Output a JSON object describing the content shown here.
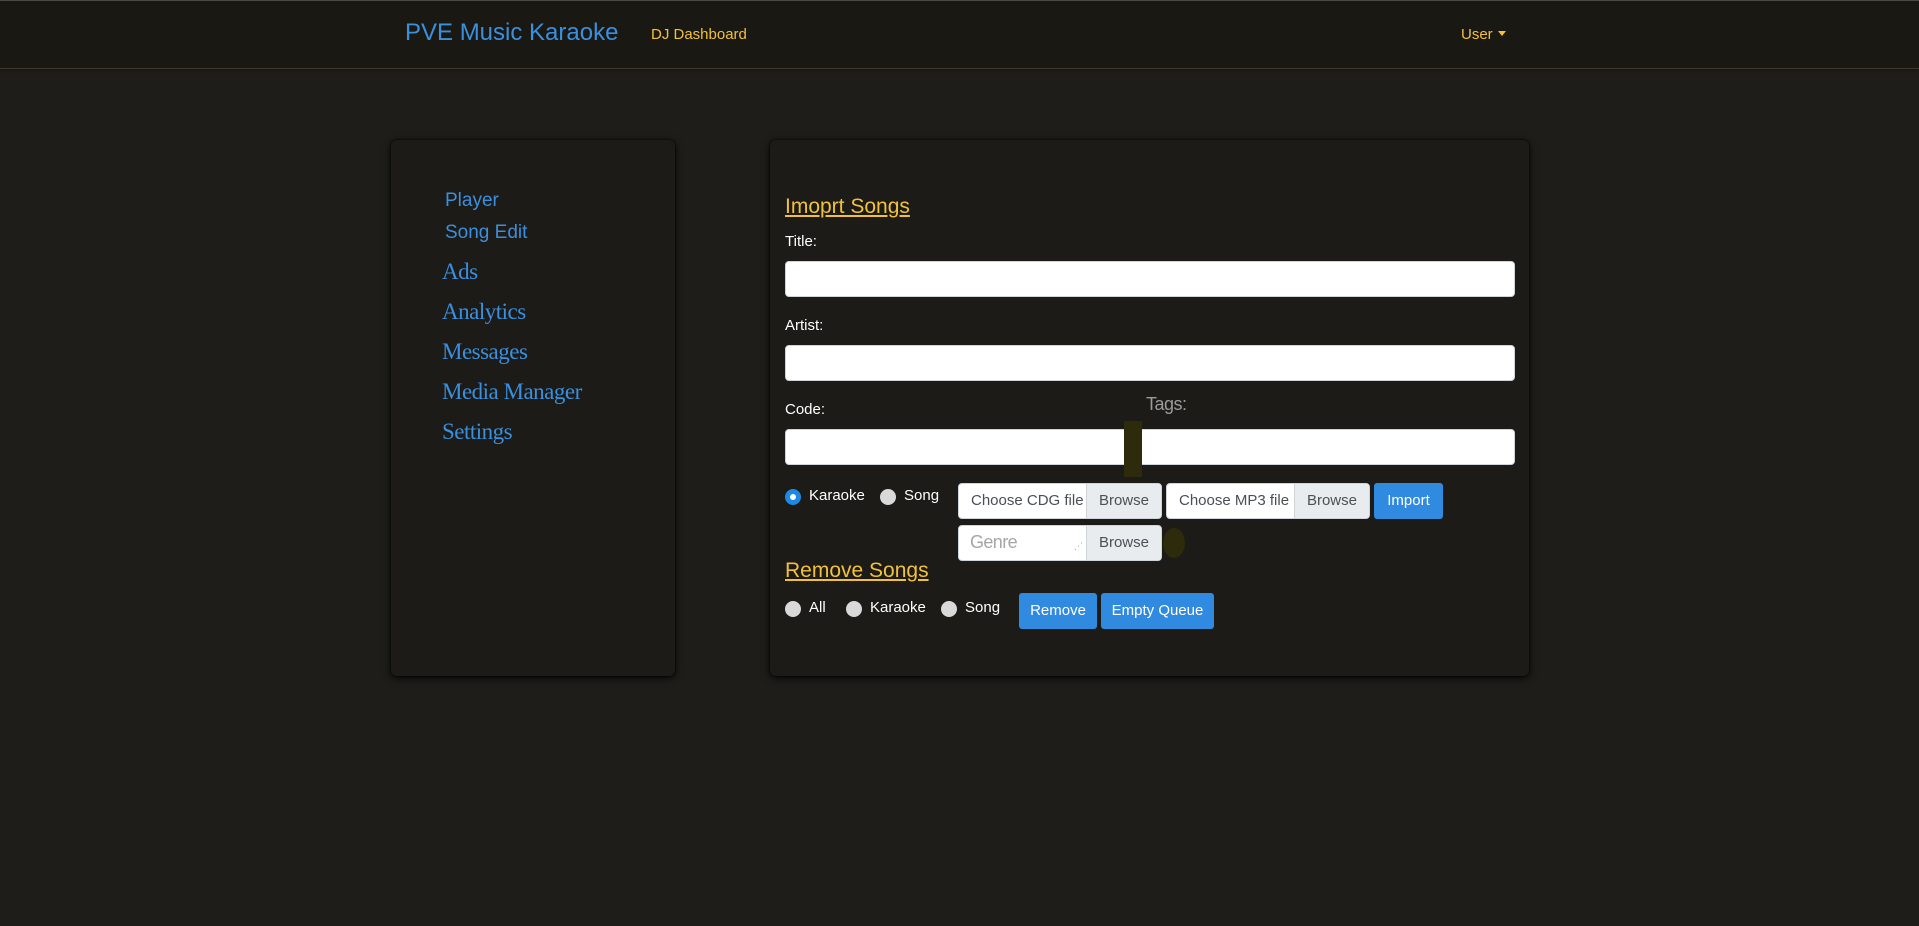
{
  "navbar": {
    "brand": "PVE Music Karaoke",
    "dj_dashboard": "DJ Dashboard",
    "user_menu": "User"
  },
  "sidebar": {
    "items": [
      {
        "label": "Player"
      },
      {
        "label": "Song Edit"
      },
      {
        "label": "Ads"
      },
      {
        "label": "Analytics"
      },
      {
        "label": "Messages"
      },
      {
        "label": "Media Manager"
      },
      {
        "label": "Settings"
      }
    ]
  },
  "import": {
    "heading": "Imoprt Songs",
    "title_label": "Title:",
    "title_value": "",
    "artist_label": "Artist:",
    "artist_value": "",
    "code_label": "Code:",
    "code_value": "",
    "tags_label": "Tags:",
    "type_options": [
      {
        "label": "Karaoke",
        "checked": true
      },
      {
        "label": "Song",
        "checked": false
      }
    ],
    "cdg_placeholder": "Choose CDG file",
    "cdg_browse": "Browse",
    "mp3_placeholder": "Choose MP3 file",
    "mp3_browse": "Browse",
    "import_button": "Import",
    "genre_placeholder": "Genre",
    "genre_browse": "Browse"
  },
  "remove": {
    "heading": "Remove Songs",
    "options": [
      {
        "label": "All",
        "checked": false
      },
      {
        "label": "Karaoke",
        "checked": false
      },
      {
        "label": "Song",
        "checked": false
      }
    ],
    "remove_button": "Remove",
    "empty_queue_button": "Empty Queue"
  },
  "colors": {
    "background": "#1e1d19",
    "link_blue": "#3a8fde",
    "accent_yellow": "#f2c13b",
    "button_blue": "#2f8ae0"
  }
}
